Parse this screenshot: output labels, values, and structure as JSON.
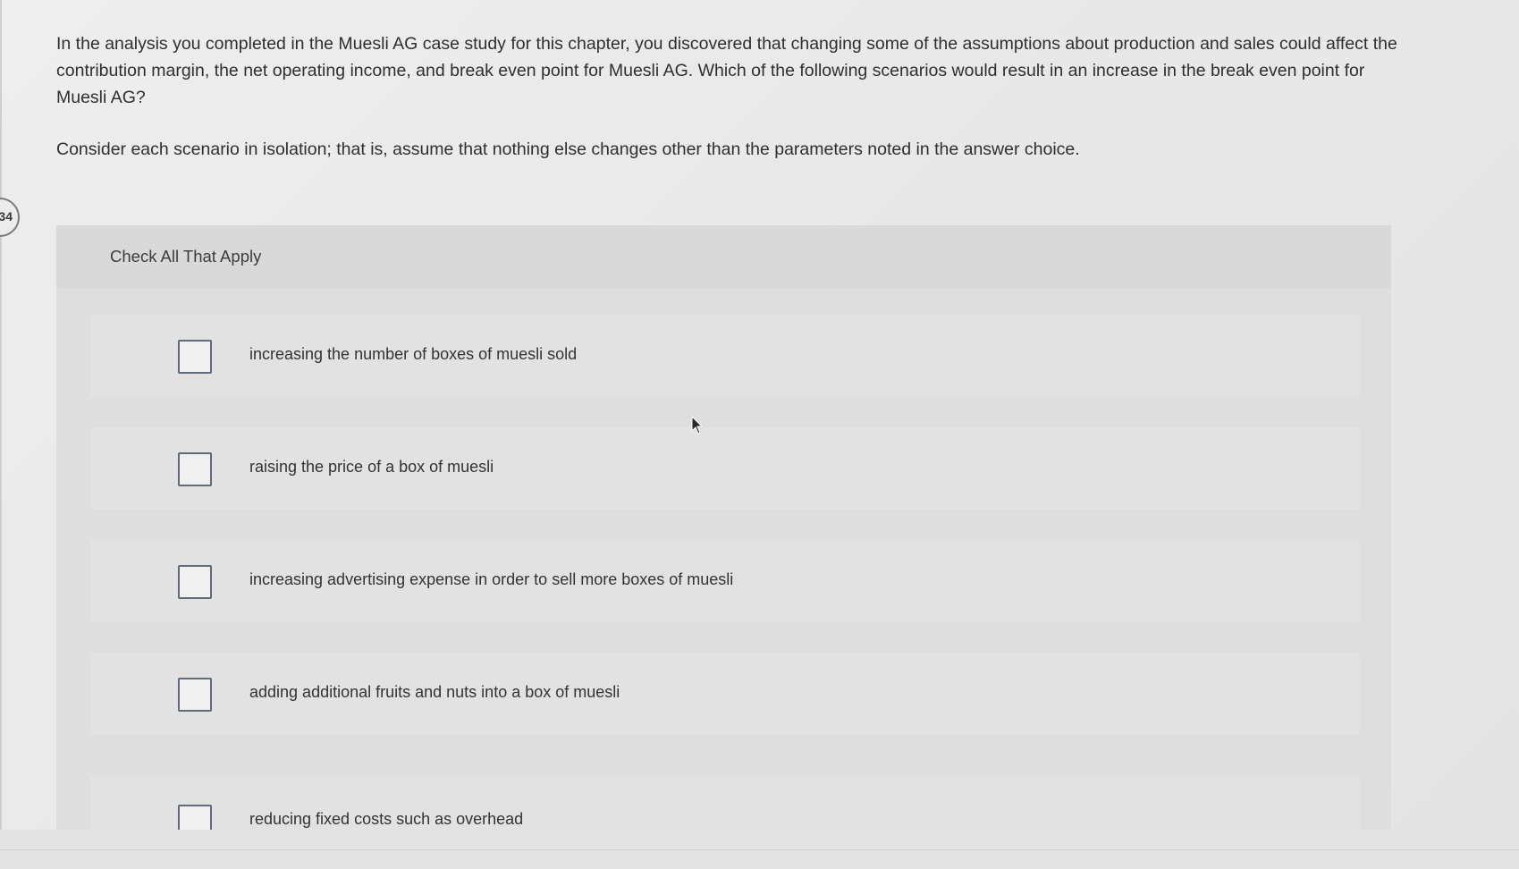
{
  "question": {
    "number": "34",
    "prompt": "In the analysis you completed in the Muesli AG case study for this chapter, you discovered that changing some of the assumptions about production and sales could affect the contribution margin, the net operating income, and break even point for Muesli AG. Which of the following scenarios would result in an increase in the break even point for Muesli AG?",
    "instruction": "Consider each scenario in isolation; that is, assume that nothing else changes other than the parameters noted in the answer choice."
  },
  "answer_panel": {
    "header": "Check All That Apply",
    "options": [
      {
        "label": "increasing the number of boxes of muesli sold",
        "checked": false
      },
      {
        "label": "raising the price of a box of muesli",
        "checked": false
      },
      {
        "label": "increasing advertising expense in order to sell more boxes of muesli",
        "checked": false
      },
      {
        "label": "adding additional fruits and nuts into a box of muesli",
        "checked": false
      },
      {
        "label": "reducing fixed costs such as overhead",
        "checked": false
      }
    ]
  },
  "colors": {
    "checkbox_border": "#5f6b78",
    "text": "#2f2f2f"
  },
  "icons": {
    "cursor": "mouse-pointer-icon"
  }
}
